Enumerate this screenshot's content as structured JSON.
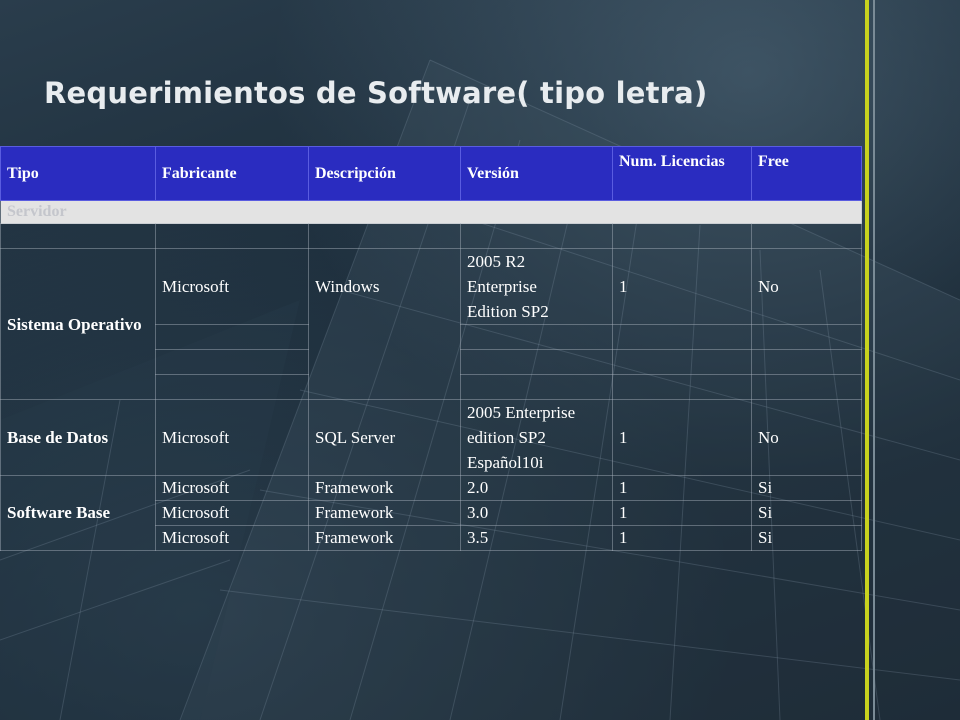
{
  "title": "Requerimientos de Software( tipo letra)",
  "colors": {
    "header_bg": "#2a2cc0",
    "section_bg": "#e3e3e3",
    "accent_line": "#c8d21e"
  },
  "table": {
    "headers": [
      "Tipo",
      "Fabricante",
      "Descripción",
      "Versión",
      "Num. Licencias",
      "Free"
    ],
    "section": "Servidor",
    "rows": {
      "so": {
        "tipo": "Sistema Operativo",
        "fabricante": "Microsoft",
        "descripcion": "Windows",
        "version_lines": [
          "2005 R2",
          "Enterprise",
          "Edition SP2"
        ],
        "licencias": "1",
        "free": "No"
      },
      "bd": {
        "tipo": "Base de Datos",
        "fabricante": "Microsoft",
        "descripcion": "SQL Server",
        "version_lines": [
          "2005 Enterprise",
          "edition SP2",
          "Español10i"
        ],
        "licencias": "1",
        "free": "No"
      },
      "sb": {
        "tipo": "Software Base",
        "items": [
          {
            "fabricante": "Microsoft",
            "descripcion": "Framework",
            "version": "2.0",
            "licencias": "1",
            "free": "Si"
          },
          {
            "fabricante": "Microsoft",
            "descripcion": "Framework",
            "version": "3.0",
            "licencias": "1",
            "free": "Si"
          },
          {
            "fabricante": "Microsoft",
            "descripcion": "Framework",
            "version": "3.5",
            "licencias": "1",
            "free": "Si"
          }
        ]
      }
    }
  }
}
